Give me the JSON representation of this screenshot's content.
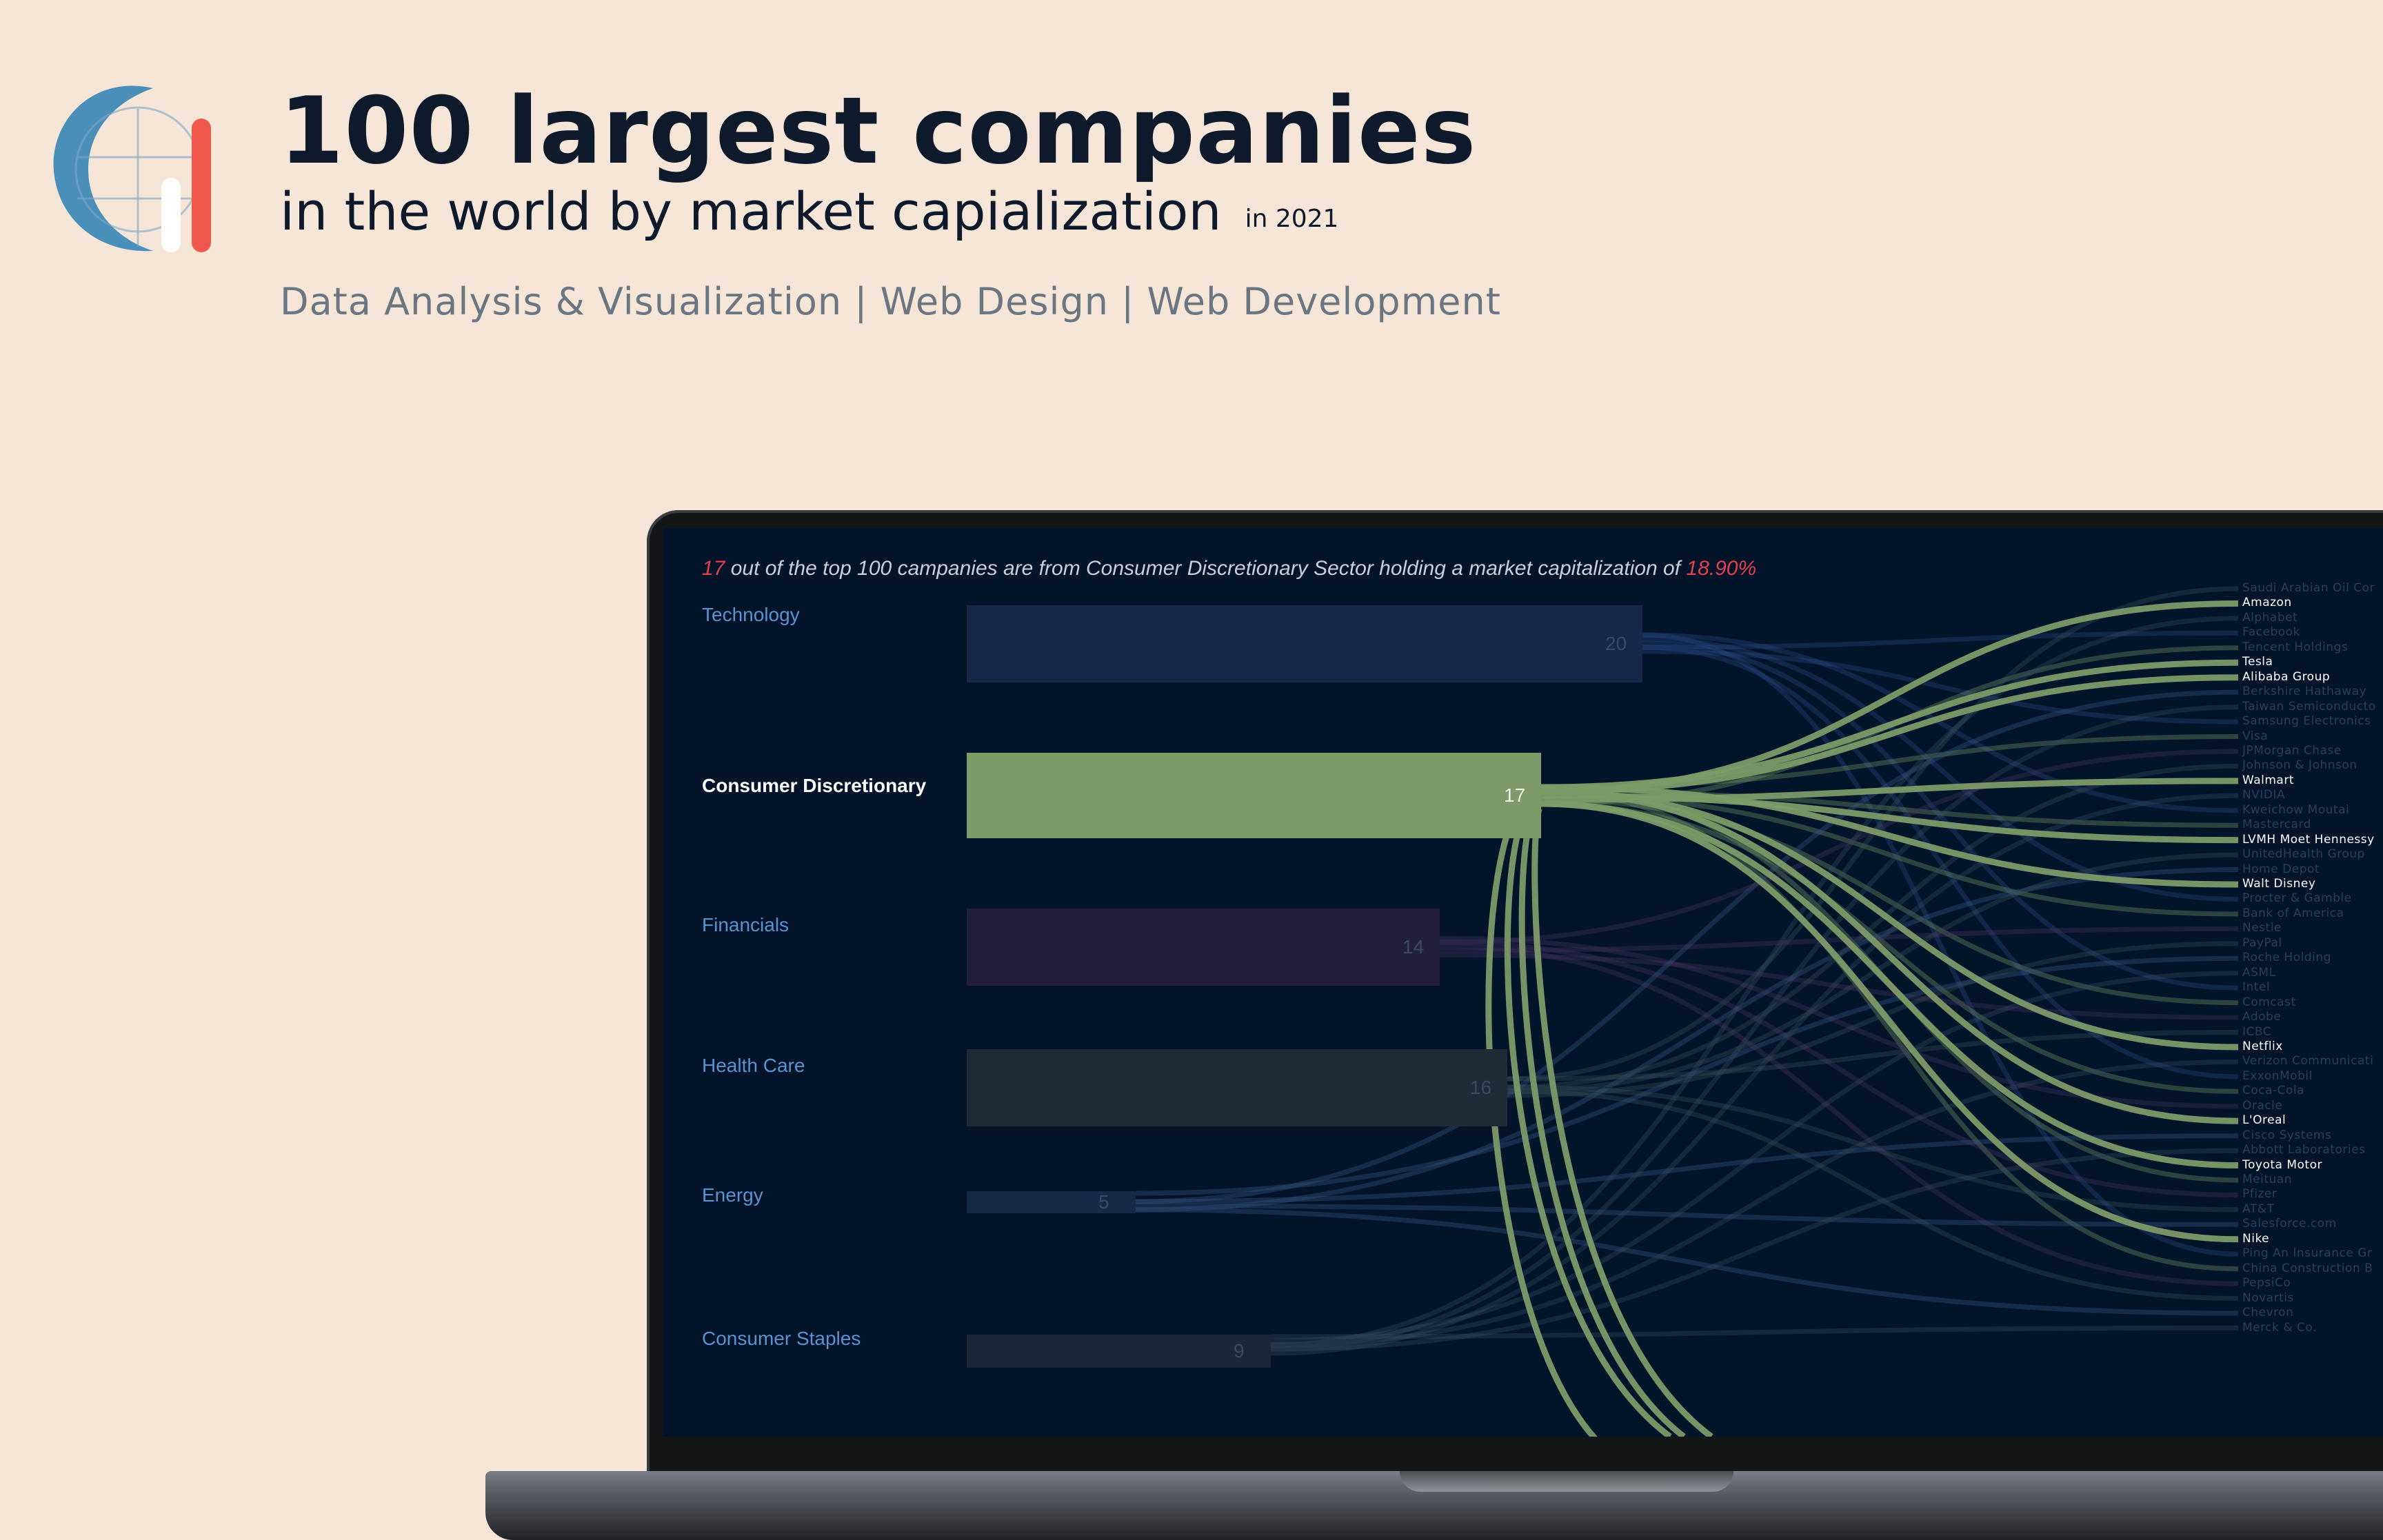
{
  "header": {
    "title": "100 largest companies",
    "subtitle": "in the world by market capialization",
    "year": "in 2021",
    "tagline": "Data Analysis & Visualization | Web Design | Web Development"
  },
  "colors": {
    "background": "#f6e6d8",
    "screen": "#03142a",
    "highlight_flow": "#7d9a68",
    "accent_red": "#e0414f",
    "logo_blue": "#4a8fba",
    "logo_red": "#f0574b"
  },
  "chart": {
    "headline_count": "17",
    "headline_text": " out of the top 100 campanies are from Consumer Discretionary Sector holding a market capitalization of ",
    "headline_percent": "18.90%",
    "active_sector": "Consumer Discretionary"
  },
  "chart_data": {
    "type": "sankey",
    "title": "",
    "sectors": [
      {
        "name": "Technology",
        "count": 20
      },
      {
        "name": "Consumer Discretionary",
        "count": 17
      },
      {
        "name": "Financials",
        "count": 14
      },
      {
        "name": "Health Care",
        "count": 16
      },
      {
        "name": "Energy",
        "count": 5
      },
      {
        "name": "Consumer Staples",
        "count": 9
      }
    ],
    "companies": [
      "Saudi Arabian Oil Cor",
      "Amazon",
      "Alphabet",
      "Facebook",
      "Tencent Holdings",
      "Tesla",
      "Alibaba Group",
      "Berkshire Hathaway",
      "Taiwan Semiconducto",
      "Samsung Electronics",
      "Visa",
      "JPMorgan Chase",
      "Johnson & Johnson",
      "Walmart",
      "NVIDIA",
      "Kweichow Moutai",
      "Mastercard",
      "LVMH Moet Hennessy",
      "UnitedHealth Group",
      "Home Depot",
      "Walt Disney",
      "Procter & Gamble",
      "Bank of America",
      "Nestle",
      "PayPal",
      "Roche Holding",
      "ASML",
      "Intel",
      "Comcast",
      "Adobe",
      "ICBC",
      "Netflix",
      "Verizon Communicati",
      "ExxonMobil",
      "Coca-Cola",
      "Oracle",
      "L'Oreal",
      "Cisco Systems",
      "Abbott Laboratories",
      "Toyota Motor",
      "Meituan",
      "Pfizer",
      "AT&T",
      "Salesforce.com",
      "Nike",
      "Ping An Insurance Gr",
      "China Construction B",
      "PepsiCo",
      "Novartis",
      "Chevron",
      "Merck & Co."
    ],
    "highlighted_companies": [
      "Amazon",
      "Tesla",
      "Alibaba Group",
      "Walmart",
      "LVMH Moet Hennessy",
      "Walt Disney",
      "Netflix",
      "L'Oreal",
      "Toyota Motor",
      "Nike"
    ]
  }
}
